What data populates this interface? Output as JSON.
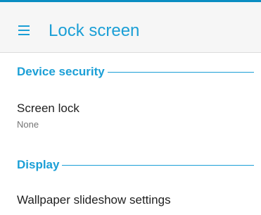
{
  "app_bar": {
    "title": "Lock screen",
    "menu_icon": "hamburger-menu-icon"
  },
  "colors": {
    "accent": "#1b9fd6",
    "status_accent": "#0a8dc2",
    "app_bar_bg": "#f6f6f6",
    "primary_text": "#212121",
    "secondary_text": "#757575"
  },
  "sections": {
    "device_security": {
      "header": "Device security",
      "screen_lock": {
        "title": "Screen lock",
        "summary": "None"
      }
    },
    "display": {
      "header": "Display",
      "wallpaper_slideshow": {
        "title": "Wallpaper slideshow settings"
      }
    }
  }
}
